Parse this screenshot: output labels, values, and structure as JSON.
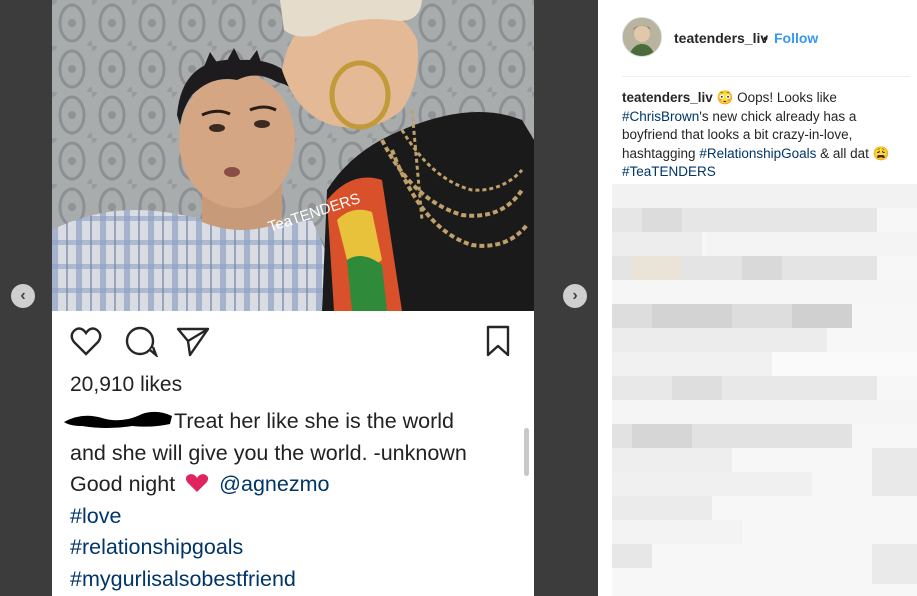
{
  "post": {
    "watermark": "TeaTENDERS",
    "likes": "20,910 likes",
    "caption_line1": "Treat her like she is the world",
    "caption_line2": "and she will give you the world. -unknown",
    "caption_line3_a": "Good night",
    "caption_line3_mention": "@agnezmo",
    "hashtag1": "#love",
    "hashtag2": "#relationshipgoals",
    "hashtag3": "#mygurlisalsobestfriend"
  },
  "sidebar": {
    "username": "teatenders_liv",
    "dot": "•",
    "follow": "Follow",
    "caption_user": "teatenders_liv",
    "caption_emoji1": "😳",
    "caption_t1": " Oops! Looks like ",
    "caption_tag1": "#ChrisBrown",
    "caption_t2": "'s new chick already has a boyfriend that looks a bit crazy-in-love, hashtagging ",
    "caption_tag2": "#RelationshipGoals",
    "caption_t3": " & all dat ",
    "caption_emoji2": "😩",
    "caption_tag3": "#TeaTENDERS"
  },
  "nav": {
    "prev": "‹",
    "next": "›"
  },
  "colors": {
    "accent": "#3897f0",
    "hashtag": "#003569",
    "heart": "#e0245e"
  }
}
